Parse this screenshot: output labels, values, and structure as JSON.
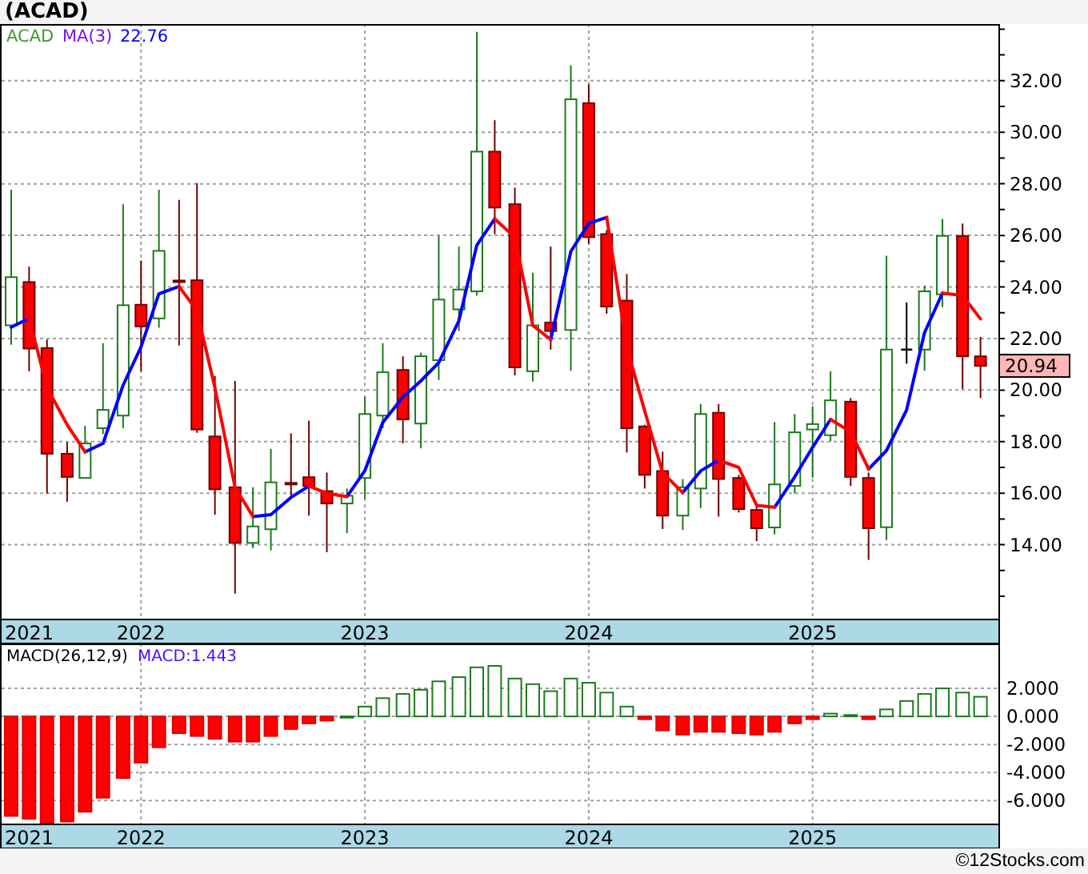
{
  "title": "(ACAD)",
  "price_panel": {
    "legend": {
      "symbol": "ACAD",
      "indicator": "MA(3)",
      "value": "22.76"
    },
    "last_price": "20.94",
    "axis_start_label": "2021",
    "chart_data": {
      "type": "candlestick",
      "grid": true,
      "ylim": [
        11.1,
        34.2
      ],
      "xlim": [
        2021.37,
        2025.83
      ],
      "x": [
        2021.42,
        2021.5,
        2021.58,
        2021.67,
        2021.75,
        2021.83,
        2021.92,
        2022.0,
        2022.08,
        2022.17,
        2022.25,
        2022.33,
        2022.42,
        2022.5,
        2022.58,
        2022.67,
        2022.75,
        2022.83,
        2022.92,
        2023.0,
        2023.08,
        2023.17,
        2023.25,
        2023.33,
        2023.42,
        2023.5,
        2023.58,
        2023.67,
        2023.75,
        2023.83,
        2023.92,
        2024.0,
        2024.08,
        2024.17,
        2024.25,
        2024.33,
        2024.42,
        2024.5,
        2024.58,
        2024.67,
        2024.75,
        2024.83,
        2024.92,
        2025.0,
        2025.08,
        2025.17,
        2025.25,
        2025.33,
        2025.42,
        2025.5,
        2025.58,
        2025.67,
        2025.75
      ],
      "yticks": [
        {
          "value": 14,
          "label": "14.00"
        },
        {
          "value": 16,
          "label": "16.00"
        },
        {
          "value": 18,
          "label": "18.00"
        },
        {
          "value": 20,
          "label": "20.00"
        },
        {
          "value": 22,
          "label": "22.00"
        },
        {
          "value": 24,
          "label": "24.00"
        },
        {
          "value": 26,
          "label": "26.00"
        },
        {
          "value": 28,
          "label": "28.00"
        },
        {
          "value": 30,
          "label": "30.00"
        },
        {
          "value": 32,
          "label": "32.00"
        }
      ],
      "xticks": [
        {
          "value": 2022,
          "label": "2022"
        },
        {
          "value": 2023,
          "label": "2023"
        },
        {
          "value": 2024,
          "label": "2024"
        },
        {
          "value": 2025,
          "label": "2025"
        }
      ],
      "ohlc": [
        [
          22.51,
          27.77,
          21.76,
          24.38
        ],
        [
          24.19,
          24.79,
          20.73,
          21.61
        ],
        [
          21.63,
          21.96,
          15.99,
          17.53
        ],
        [
          17.53,
          17.98,
          15.67,
          16.63
        ],
        [
          16.59,
          18.61,
          16.59,
          17.93
        ],
        [
          18.52,
          21.82,
          18.29,
          19.23
        ],
        [
          19.01,
          27.21,
          18.52,
          23.29
        ],
        [
          23.31,
          25.02,
          20.73,
          22.47
        ],
        [
          22.78,
          27.77,
          22.42,
          25.4
        ],
        [
          24.25,
          27.38,
          21.73,
          24.2
        ],
        [
          24.26,
          28.03,
          18.34,
          18.47
        ],
        [
          18.2,
          20.55,
          15.16,
          16.15
        ],
        [
          16.23,
          20.35,
          12.1,
          14.07
        ],
        [
          14.07,
          16.23,
          13.87,
          14.71
        ],
        [
          14.6,
          17.72,
          13.78,
          16.42
        ],
        [
          16.4,
          18.32,
          15.91,
          16.36
        ],
        [
          16.62,
          18.81,
          15.13,
          16.28
        ],
        [
          16.08,
          16.8,
          13.71,
          15.6
        ],
        [
          15.6,
          16.18,
          14.45,
          15.9
        ],
        [
          16.59,
          19.73,
          15.77,
          19.07
        ],
        [
          19.01,
          21.82,
          18.52,
          20.69
        ],
        [
          20.78,
          21.31,
          17.93,
          18.86
        ],
        [
          18.7,
          21.45,
          17.74,
          21.31
        ],
        [
          21.16,
          25.98,
          20.39,
          23.51
        ],
        [
          23.13,
          25.57,
          22.29,
          23.9
        ],
        [
          23.83,
          33.9,
          23.67,
          29.25
        ],
        [
          29.25,
          30.47,
          26.05,
          27.08
        ],
        [
          27.21,
          27.85,
          20.57,
          20.88
        ],
        [
          20.73,
          24.55,
          20.33,
          22.51
        ],
        [
          22.62,
          25.57,
          21.57,
          22.29
        ],
        [
          22.33,
          32.6,
          20.75,
          31.28
        ],
        [
          31.13,
          31.86,
          25.67,
          25.93
        ],
        [
          26.05,
          26.21,
          22.96,
          23.24
        ],
        [
          23.47,
          24.5,
          17.58,
          18.52
        ],
        [
          18.59,
          18.65,
          16.18,
          16.71
        ],
        [
          16.86,
          17.61,
          14.61,
          15.13
        ],
        [
          15.13,
          16.55,
          14.57,
          16.23
        ],
        [
          16.18,
          19.46,
          15.42,
          19.07
        ],
        [
          19.12,
          19.46,
          15.09,
          16.55
        ],
        [
          16.59,
          16.71,
          15.25,
          15.38
        ],
        [
          15.35,
          15.48,
          14.14,
          14.64
        ],
        [
          14.67,
          18.76,
          14.4,
          16.34
        ],
        [
          16.28,
          19.07,
          15.99,
          18.36
        ],
        [
          18.47,
          19.37,
          16.6,
          18.68
        ],
        [
          18.25,
          20.73,
          18.02,
          19.6
        ],
        [
          19.55,
          19.69,
          16.28,
          16.63
        ],
        [
          16.59,
          16.8,
          13.41,
          14.64
        ],
        [
          14.68,
          25.21,
          14.18,
          21.57
        ],
        [
          21.57,
          23.4,
          21.02,
          21.57
        ],
        [
          21.57,
          24.05,
          20.75,
          23.83
        ],
        [
          23.71,
          26.64,
          23.22,
          25.98
        ],
        [
          25.98,
          26.46,
          20.04,
          21.31
        ],
        [
          21.31,
          22.06,
          19.69,
          20.94
        ]
      ],
      "series": [
        {
          "type": "line",
          "color": "#0000ff",
          "values": [
            22.44,
            22.78,
            null,
            null,
            17.6,
            17.93,
            20.2,
            21.67,
            23.73,
            24.02,
            null,
            null,
            null,
            15.09,
            15.17,
            15.84,
            16.28,
            null,
            15.87,
            16.88,
            18.74,
            19.73,
            20.35,
            21.06,
            22.69,
            25.62,
            26.64,
            null,
            null,
            21.96,
            25.38,
            26.46,
            26.7,
            null,
            null,
            null,
            16.02,
            16.86,
            17.28,
            null,
            null,
            15.45,
            16.63,
            17.78,
            18.86,
            null,
            16.93,
            17.65,
            19.22,
            22.22,
            23.76,
            null,
            null
          ]
        },
        {
          "type": "line",
          "color": "#ff0000",
          "values": [
            null,
            22.78,
            20.1,
            18.65,
            17.6,
            null,
            null,
            null,
            null,
            24.02,
            23.07,
            20.1,
            16.23,
            15.09,
            null,
            null,
            16.28,
            15.99,
            15.87,
            null,
            null,
            null,
            null,
            null,
            null,
            null,
            26.64,
            25.93,
            22.51,
            21.96,
            null,
            null,
            26.7,
            21.67,
            19.2,
            16.8,
            16.02,
            null,
            17.28,
            17.0,
            15.53,
            15.45,
            null,
            null,
            18.86,
            18.38,
            16.93,
            null,
            null,
            null,
            23.76,
            23.67,
            22.76
          ]
        }
      ]
    }
  },
  "macd_panel": {
    "legend": {
      "value": "MACD:1.443"
    },
    "axis_start_label": "2021",
    "chart_data": {
      "type": "bar",
      "grid": true,
      "ylim": [
        -7.7,
        5.2
      ],
      "xlim": [
        2021.37,
        2025.83
      ],
      "x": [
        2021.42,
        2021.5,
        2021.58,
        2021.67,
        2021.75,
        2021.83,
        2021.92,
        2022.0,
        2022.08,
        2022.17,
        2022.25,
        2022.33,
        2022.42,
        2022.5,
        2022.58,
        2022.67,
        2022.75,
        2022.83,
        2022.92,
        2023.0,
        2023.08,
        2023.17,
        2023.25,
        2023.33,
        2023.42,
        2023.5,
        2023.58,
        2023.67,
        2023.75,
        2023.83,
        2023.92,
        2024.0,
        2024.08,
        2024.17,
        2024.25,
        2024.33,
        2024.42,
        2024.5,
        2024.58,
        2024.67,
        2024.75,
        2024.83,
        2024.92,
        2025.0,
        2025.08,
        2025.17,
        2025.25,
        2025.33,
        2025.42,
        2025.5,
        2025.58,
        2025.67,
        2025.75
      ],
      "yticks": [
        {
          "value": 2,
          "label": "2.000"
        },
        {
          "value": 0,
          "label": "0.000"
        },
        {
          "value": -2,
          "label": "-2.000"
        },
        {
          "value": -4,
          "label": "-4.000"
        },
        {
          "value": -6,
          "label": "-6.000"
        }
      ],
      "xticks": [
        {
          "value": 2022,
          "label": "2022"
        },
        {
          "value": 2023,
          "label": "2023"
        },
        {
          "value": 2024,
          "label": "2024"
        },
        {
          "value": 2025,
          "label": "2025"
        }
      ],
      "series": [
        {
          "name": "MACD(26,12,9)",
          "values": [
            -7.1,
            -7.3,
            -7.6,
            -7.5,
            -6.8,
            -5.8,
            -4.4,
            -3.3,
            -2.2,
            -1.2,
            -1.4,
            -1.6,
            -1.8,
            -1.8,
            -1.4,
            -0.9,
            -0.5,
            -0.3,
            0.0,
            0.7,
            1.3,
            1.6,
            1.9,
            2.5,
            2.8,
            3.5,
            3.6,
            2.7,
            2.3,
            1.8,
            2.7,
            2.4,
            1.7,
            0.7,
            -0.2,
            -1.0,
            -1.3,
            -1.1,
            -1.1,
            -1.2,
            -1.3,
            -1.1,
            -0.5,
            -0.2,
            0.2,
            0.1,
            -0.2,
            0.5,
            1.1,
            1.6,
            2.0,
            1.7,
            1.4
          ]
        }
      ]
    }
  },
  "credit": "©12Stocks.com"
}
